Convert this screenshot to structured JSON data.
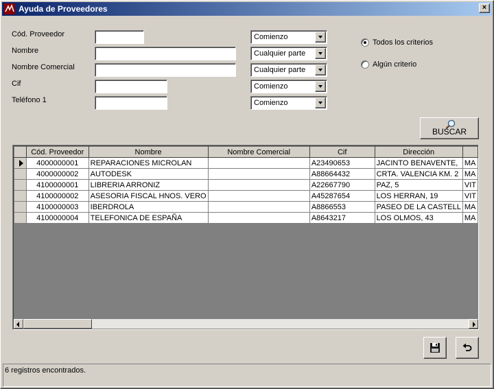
{
  "window": {
    "title": "Ayuda de Proveedores",
    "close_glyph": "×"
  },
  "form": {
    "fields": [
      {
        "label": "Cód. Proveedor",
        "value": "",
        "match": "Comienzo"
      },
      {
        "label": "Nombre",
        "value": "",
        "match": "Cualquier parte"
      },
      {
        "label": "Nombre Comercial",
        "value": "",
        "match": "Cualquier parte"
      },
      {
        "label": "Cif",
        "value": "",
        "match": "Comienzo"
      },
      {
        "label": "Teléfono 1",
        "value": "",
        "match": "Comienzo"
      }
    ],
    "criteria": [
      {
        "label": "Todos los criterios",
        "checked": true
      },
      {
        "label": "Algún criterio",
        "checked": false
      }
    ],
    "search_button": "BUSCAR"
  },
  "grid": {
    "columns": [
      "Cód. Proveedor",
      "Nombre",
      "Nombre Comercial",
      "Cif",
      "Dirección"
    ],
    "rows": [
      {
        "cod": "4000000001",
        "nombre": "REPARACIONES MICROLAN",
        "comercial": "",
        "cif": "A23490653",
        "direccion": "JACINTO BENAVENTE,",
        "extra": "MA"
      },
      {
        "cod": "4000000002",
        "nombre": "AUTODESK",
        "comercial": "",
        "cif": "A88664432",
        "direccion": "CRTA. VALENCIA KM. 2",
        "extra": "MA"
      },
      {
        "cod": "4100000001",
        "nombre": "LIBRERIA ARRONIZ",
        "comercial": "",
        "cif": "A22667790",
        "direccion": "PAZ, 5",
        "extra": "VIT"
      },
      {
        "cod": "4100000002",
        "nombre": "ASESORIA FISCAL HNOS. VERO",
        "comercial": "",
        "cif": "A45287654",
        "direccion": "LOS HERRAN, 19",
        "extra": "VIT"
      },
      {
        "cod": "4100000003",
        "nombre": "IBERDROLA",
        "comercial": "",
        "cif": "A8866553",
        "direccion": "PASEO DE LA CASTELL",
        "extra": "MA"
      },
      {
        "cod": "4100000004",
        "nombre": "TELEFONICA DE ESPAÑA",
        "comercial": "",
        "cif": "A8643217",
        "direccion": "LOS OLMOS, 43",
        "extra": "MA"
      }
    ]
  },
  "status": {
    "text": "6 registros encontrados."
  },
  "colors": {
    "titlebar_start": "#0a246a",
    "titlebar_end": "#a6caf0",
    "face": "#d4d0c8",
    "grid_empty": "#808080"
  }
}
